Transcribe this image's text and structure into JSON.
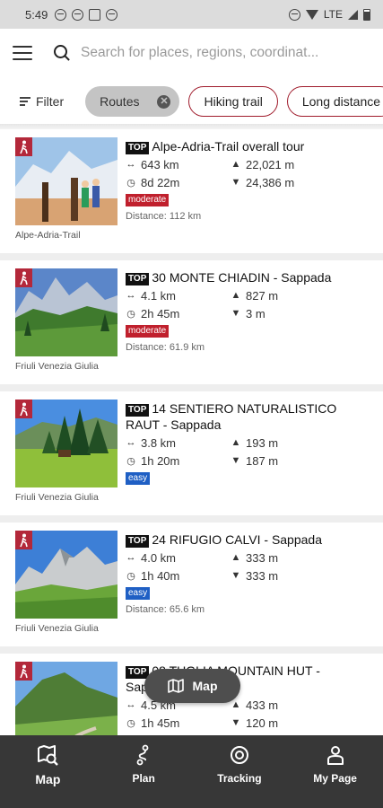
{
  "status_bar": {
    "time": "5:49",
    "network": "LTE"
  },
  "search": {
    "placeholder": "Search for places, regions, coordinat..."
  },
  "filters": {
    "filter_label": "Filter",
    "active_chip": "Routes",
    "chips": [
      "Hiking trail",
      "Long distance"
    ]
  },
  "routes": [
    {
      "top": "TOP",
      "title": "Alpe-Adria-Trail overall tour",
      "distance": "643 km",
      "duration": "8d 22m",
      "ascent": "22,021 m",
      "descent": "24,386 m",
      "difficulty": "moderate",
      "distance_from": "Distance: 112 km",
      "region": "Alpe-Adria-Trail"
    },
    {
      "top": "TOP",
      "title": "30 MONTE CHIADIN - Sappada",
      "distance": "4.1 km",
      "duration": "2h 45m",
      "ascent": "827 m",
      "descent": "3 m",
      "difficulty": "moderate",
      "distance_from": "Distance: 61.9 km",
      "region": "Friuli Venezia Giulia"
    },
    {
      "top": "TOP",
      "title": "14 SENTIERO NATURALISTICO RAUT - Sappada",
      "distance": "3.8 km",
      "duration": "1h 20m",
      "ascent": "193 m",
      "descent": "187 m",
      "difficulty": "easy",
      "distance_from": "",
      "region": "Friuli Venezia Giulia"
    },
    {
      "top": "TOP",
      "title": "24 RIFUGIO CALVI - Sappada",
      "distance": "4.0 km",
      "duration": "1h 40m",
      "ascent": "333 m",
      "descent": "333 m",
      "difficulty": "easy",
      "distance_from": "Distance: 65.6 km",
      "region": "Friuli Venezia Giulia"
    },
    {
      "top": "TOP",
      "title": "08 TUGLIA MOUNTAIN HUT - Sap",
      "distance": "4.5 km",
      "duration": "1h 45m",
      "ascent": "433 m",
      "descent": "120 m",
      "difficulty": "",
      "distance_from": "",
      "region": ""
    }
  ],
  "map_button": {
    "label": "Map"
  },
  "bottom_nav": [
    {
      "label": "Map",
      "icon": "map-search-icon"
    },
    {
      "label": "Plan",
      "icon": "route-plan-icon"
    },
    {
      "label": "Tracking",
      "icon": "tracking-icon"
    },
    {
      "label": "My Page",
      "icon": "user-icon"
    }
  ],
  "colors": {
    "accent": "#b3283a",
    "moderate": "#c0202d",
    "easy": "#1f5fc4",
    "nav_bg": "#373737"
  }
}
